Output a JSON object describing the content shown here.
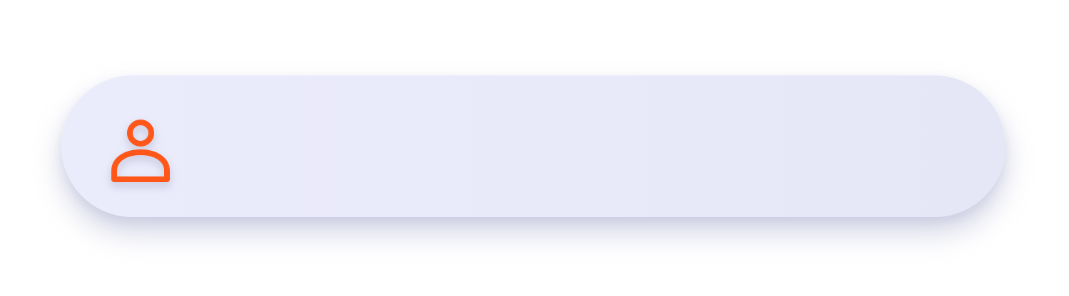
{
  "username_field": {
    "icon": "user-icon",
    "value": "",
    "placeholder": ""
  },
  "colors": {
    "page_background": "#ffffff",
    "field_background": "#e8e9f9",
    "icon_accent": "#ff5719"
  }
}
